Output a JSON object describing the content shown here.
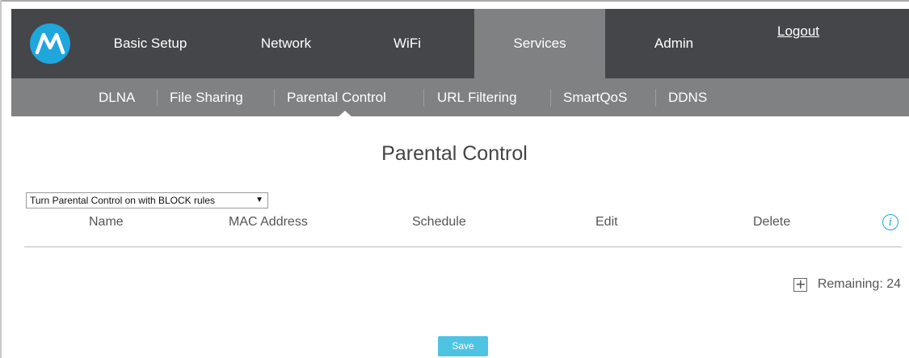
{
  "colors": {
    "topbar": "#444649",
    "active_tab": "#7f8183",
    "subbar": "#7f8183",
    "logo": "#1fa6dc",
    "info_icon": "#1fa6dc",
    "save_button": "#4ec3e2"
  },
  "header": {
    "logo_icon": "motorola-logo-icon",
    "nav": [
      {
        "label": "Basic Setup"
      },
      {
        "label": "Network"
      },
      {
        "label": "WiFi"
      },
      {
        "label": "Services",
        "active": true
      },
      {
        "label": "Admin"
      }
    ],
    "logout": "Logout"
  },
  "subnav": {
    "items": [
      {
        "label": "DLNA"
      },
      {
        "label": "File Sharing"
      },
      {
        "label": "Parental Control",
        "active": true
      },
      {
        "label": "URL Filtering"
      },
      {
        "label": "SmartQoS"
      },
      {
        "label": "DDNS"
      }
    ]
  },
  "main": {
    "title": "Parental Control",
    "mode_select": {
      "value": "Turn Parental Control on with BLOCK rules",
      "arrow": "▼"
    },
    "table": {
      "columns": [
        "Name",
        "MAC Address",
        "Schedule",
        "Edit",
        "Delete"
      ],
      "info_icon": "info-icon",
      "info_glyph": "i"
    },
    "add": {
      "icon": "plus-icon",
      "glyph": "+",
      "remaining": "Remaining: 24"
    },
    "save_label": "Save"
  }
}
